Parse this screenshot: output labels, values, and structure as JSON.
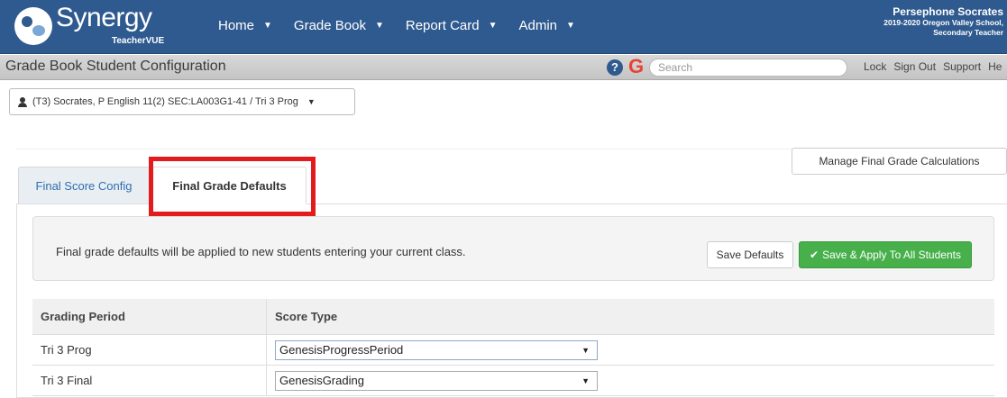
{
  "brand": {
    "name": "Synergy",
    "sub": "TeacherVUE"
  },
  "nav": [
    {
      "label": "Home"
    },
    {
      "label": "Grade Book"
    },
    {
      "label": "Report Card"
    },
    {
      "label": "Admin"
    }
  ],
  "user": {
    "name": "Persephone Socrates",
    "line1": "2019-2020 Oregon Valley School,",
    "line2": "Secondary Teacher"
  },
  "titlebar": {
    "title": "Grade Book Student Configuration",
    "search_placeholder": "Search",
    "links": [
      "Lock",
      "Sign Out",
      "Support",
      "He"
    ]
  },
  "class_selector": {
    "value": "(T3) Socrates, P English 11(2) SEC:LA003G1-41 / Tri 3 Prog"
  },
  "manage_button": "Manage Final Grade Calculations",
  "tabs": [
    {
      "label": "Final Score Config",
      "active": false
    },
    {
      "label": "Final Grade Defaults",
      "active": true
    }
  ],
  "notice": {
    "text": "Final grade defaults will be applied to new students entering your current class.",
    "save_defaults": "Save Defaults",
    "save_apply": "Save & Apply To All Students"
  },
  "table": {
    "headers": [
      "Grading Period",
      "Score Type"
    ],
    "rows": [
      {
        "period": "Tri 3 Prog",
        "score_type": "GenesisProgressPeriod"
      },
      {
        "period": "Tri 3 Final",
        "score_type": "GenesisGrading"
      }
    ]
  },
  "colors": {
    "nav_bg": "#2f5a8f",
    "highlight": "#e21c1c",
    "primary_button": "#47b04b"
  }
}
